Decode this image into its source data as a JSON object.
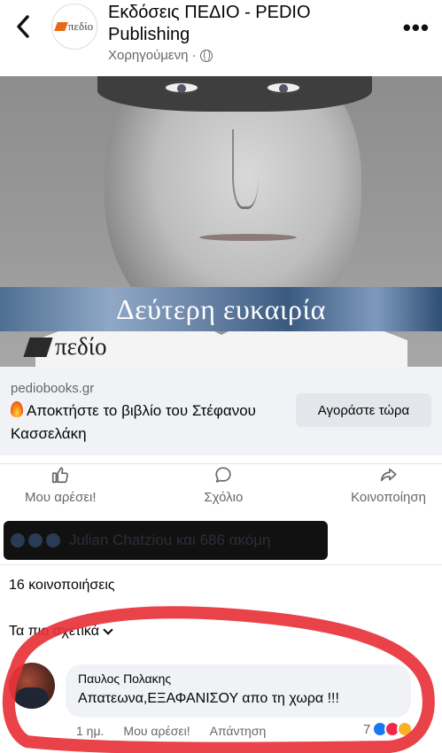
{
  "header": {
    "back_icon": "chevron-left-icon",
    "page_name": "Εκδόσεις ΠΕΔΙΟ - PEDIO Publishing",
    "avatar_text": "πεδίο",
    "sponsored": "Χορηγούμενη ·",
    "privacy_icon": "globe-icon",
    "more": "•••"
  },
  "ad": {
    "book_title": "Δεύτερη ευκαιρία",
    "brand": "πεδίο",
    "domain": "pediobooks.gr",
    "headline": "Αποκτήστε το βιβλίο του Στέφανου Κασσελάκη",
    "headline_icon": "fire-icon",
    "cta": "Αγοράστε τώρα"
  },
  "actions": {
    "like": "Μου αρέσει!",
    "comment": "Σχόλιο",
    "share": "Κοινοποίηση"
  },
  "reactions": {
    "text": "Julian Chatziou και 686 ακόμη"
  },
  "shares": "16 κοινοποιήσεις",
  "sort_label": "Τα πιο σχετικά",
  "comment": {
    "author": "Παυλος Πολακης",
    "text": "Απατεωνα,ΕΞΑΦΑΝΙΣΟΥ απο τη χωρα !!!",
    "time": "1 ημ.",
    "like": "Μου αρέσει!",
    "reply": "Απάντηση",
    "reaction_count": "7"
  },
  "colors": {
    "fb_blue": "#1877f2",
    "love_red": "#f02849",
    "marker_red": "#e8323a"
  }
}
